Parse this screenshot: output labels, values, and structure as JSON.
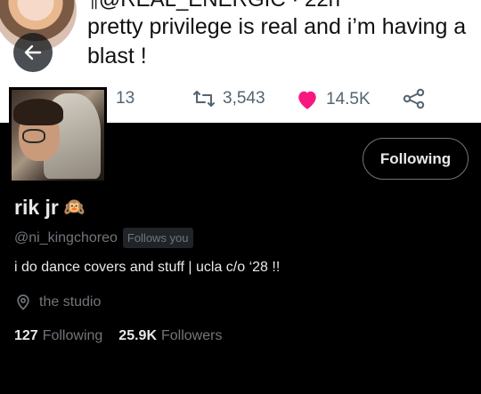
{
  "banner": {
    "handle_partial": "¶@REAL_ENERGIC · 22h",
    "tweet_text": "pretty privilege is real and i’m having a blast !",
    "replies": "13",
    "retweets": "3,543",
    "likes": "14.5K",
    "like_color": "#f91880"
  },
  "profile": {
    "display_name": "rik jr",
    "name_emoji": "🙉",
    "handle": "@ni_kingchoreo",
    "follows_you": "Follows you",
    "bio": "i do dance covers and stuff | ucla c/o ‘28 !!",
    "location": "the studio",
    "following_count": "127",
    "following_label": "Following",
    "followers_count": "25.9K",
    "followers_label": "Followers",
    "follow_button_label": "Following"
  },
  "icons": [
    "back-arrow-icon",
    "reply-icon",
    "retweet-icon",
    "heart-icon",
    "share-icon",
    "location-pin-icon"
  ]
}
